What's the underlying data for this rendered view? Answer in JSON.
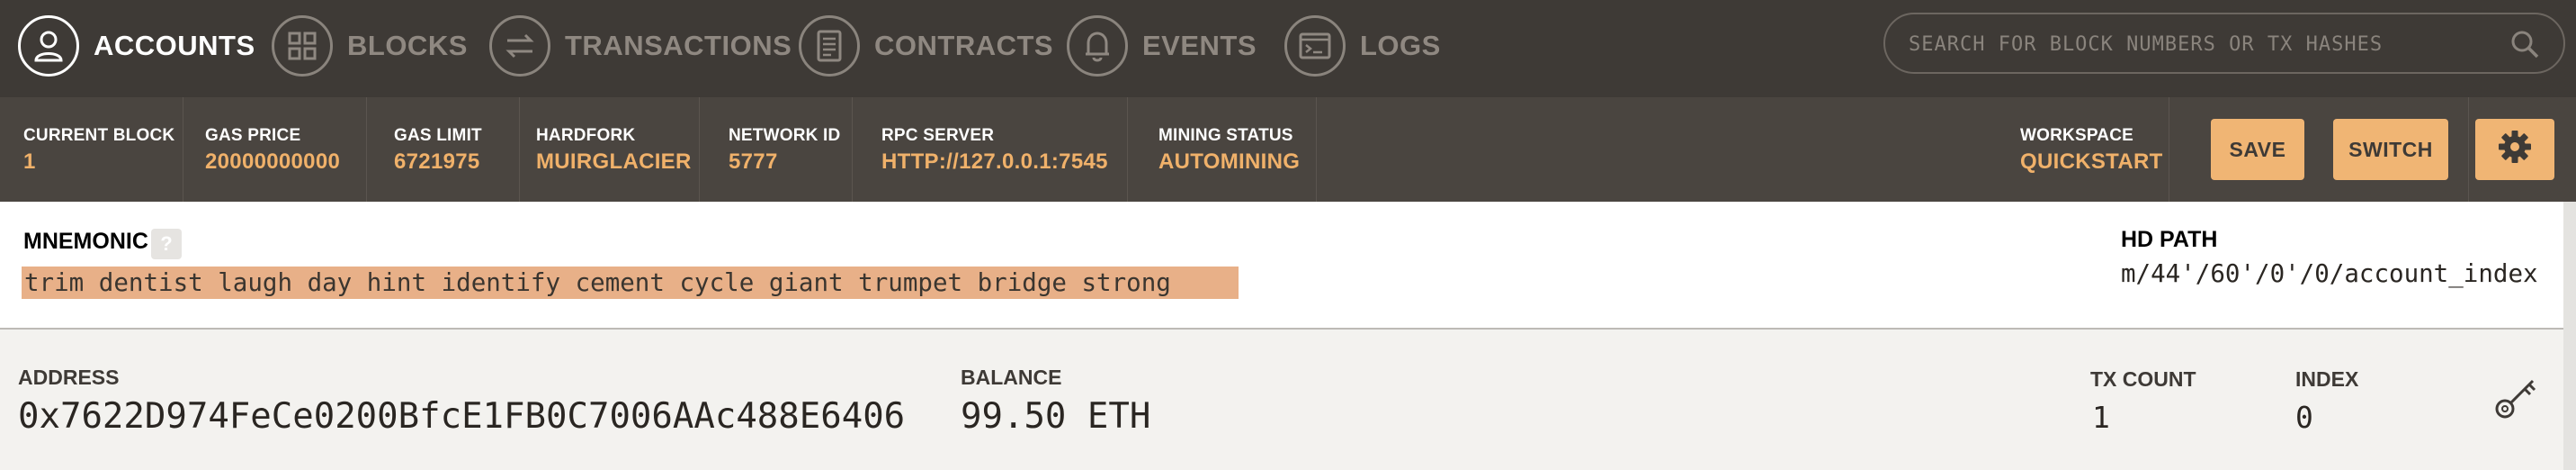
{
  "nav": {
    "items": [
      {
        "label": "ACCOUNTS",
        "icon": "account-icon",
        "active": true
      },
      {
        "label": "BLOCKS",
        "icon": "blocks-icon",
        "active": false
      },
      {
        "label": "TRANSACTIONS",
        "icon": "transactions-icon",
        "active": false
      },
      {
        "label": "CONTRACTS",
        "icon": "contracts-icon",
        "active": false
      },
      {
        "label": "EVENTS",
        "icon": "bell-icon",
        "active": false
      },
      {
        "label": "LOGS",
        "icon": "terminal-icon",
        "active": false
      }
    ],
    "search_placeholder": "SEARCH FOR BLOCK NUMBERS OR TX HASHES"
  },
  "status": {
    "current_block": {
      "label": "CURRENT BLOCK",
      "value": "1"
    },
    "gas_price": {
      "label": "GAS PRICE",
      "value": "20000000000"
    },
    "gas_limit": {
      "label": "GAS LIMIT",
      "value": "6721975"
    },
    "hardfork": {
      "label": "HARDFORK",
      "value": "MUIRGLACIER"
    },
    "network_id": {
      "label": "NETWORK ID",
      "value": "5777"
    },
    "rpc_server": {
      "label": "RPC SERVER",
      "value": "HTTP://127.0.0.1:7545"
    },
    "mining_status": {
      "label": "MINING STATUS",
      "value": "AUTOMINING"
    },
    "workspace": {
      "label": "WORKSPACE",
      "value": "QUICKSTART"
    },
    "save_label": "SAVE",
    "switch_label": "SWITCH"
  },
  "mnemonic": {
    "title": "MNEMONIC",
    "help": "?",
    "phrase": "trim dentist laugh day hint identify cement cycle giant trumpet bridge strong",
    "hd_path_title": "HD PATH",
    "hd_path_value": "m/44'/60'/0'/0/account_index"
  },
  "account": {
    "address_label": "ADDRESS",
    "address": "0x7622D974FeCe0200BfcE1FB0C7006AAc488E6406",
    "balance_label": "BALANCE",
    "balance": "99.50 ETH",
    "tx_count_label": "TX COUNT",
    "tx_count": "1",
    "index_label": "INDEX",
    "index": "0"
  },
  "colors": {
    "accent": "#f0b16a",
    "nav_bg": "#3e3a36",
    "status_bg": "#4a4540",
    "highlight": "#e8b088"
  }
}
